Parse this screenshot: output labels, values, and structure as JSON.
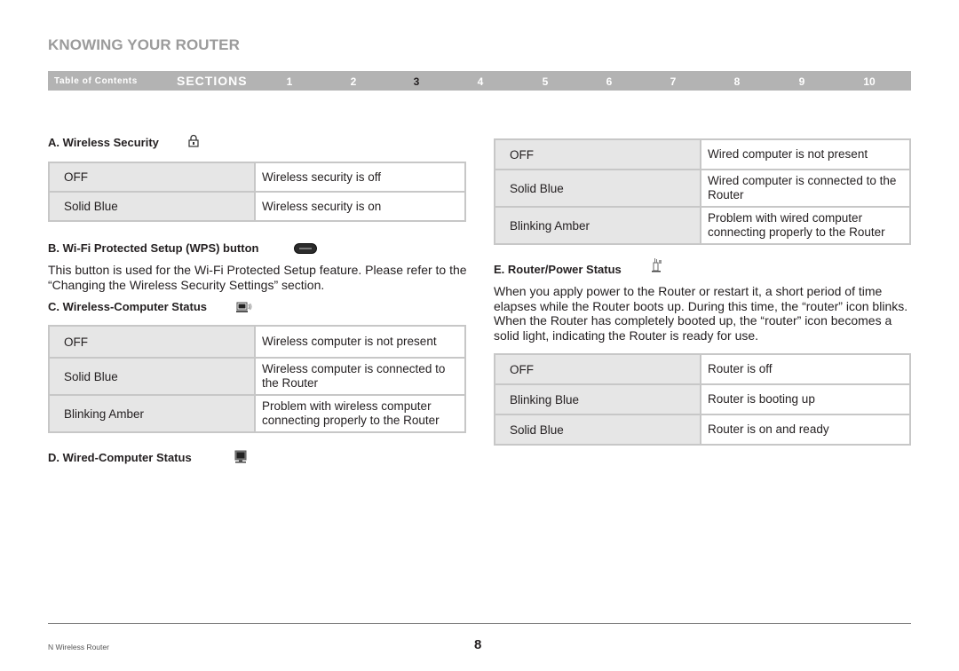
{
  "page_title": "KNOWING YOUR ROUTER",
  "nav": {
    "toc_label": "Table of Contents",
    "sections_label": "SECTIONS",
    "numbers": [
      "1",
      "2",
      "3",
      "4",
      "5",
      "6",
      "7",
      "8",
      "9",
      "10"
    ],
    "active": "3"
  },
  "sections": {
    "a": {
      "title": "A. Wireless Security",
      "icon": "lock-icon",
      "rows": [
        {
          "state": "OFF",
          "desc": "Wireless security is off"
        },
        {
          "state": "Solid Blue",
          "desc": "Wireless security is on"
        }
      ]
    },
    "b": {
      "title": "B. Wi-Fi Protected Setup (WPS) button",
      "icon": "wps-button-icon",
      "icon_label": "WPS",
      "text": "This button is used for the Wi-Fi Protected Setup feature. Please refer to the “Changing the Wireless Security Settings” section."
    },
    "c": {
      "title": "C. Wireless-Computer Status",
      "icon": "wireless-computer-icon",
      "rows": [
        {
          "state": "OFF",
          "desc": "Wireless computer is not present"
        },
        {
          "state": "Solid Blue",
          "desc": "Wireless computer is connected to the Router"
        },
        {
          "state": "Blinking Amber",
          "desc": "Problem with wireless computer connecting properly to the Router"
        }
      ]
    },
    "d": {
      "title": "D. Wired-Computer Status",
      "icon": "wired-computer-icon",
      "rows": [
        {
          "state": "OFF",
          "desc": "Wired computer is not present"
        },
        {
          "state": "Solid Blue",
          "desc": "Wired computer is connected to the Router"
        },
        {
          "state": "Blinking Amber",
          "desc": "Problem with wired computer connecting properly to the Router"
        }
      ]
    },
    "e": {
      "title": "E. Router/Power Status",
      "icon": "router-icon",
      "text": "When you apply power to the Router or restart it, a short period of time elapses while the Router boots up. During this time, the “router” icon blinks. When the Router has completely booted up, the “router” icon becomes a solid light, indicating the Router is ready for use.",
      "rows": [
        {
          "state": "OFF",
          "desc": "Router is off"
        },
        {
          "state": "Blinking Blue",
          "desc": "Router is booting up"
        },
        {
          "state": "Solid Blue",
          "desc": "Router is on and ready"
        }
      ]
    }
  },
  "footer": {
    "product": "N Wireless Router",
    "page_number": "8"
  }
}
